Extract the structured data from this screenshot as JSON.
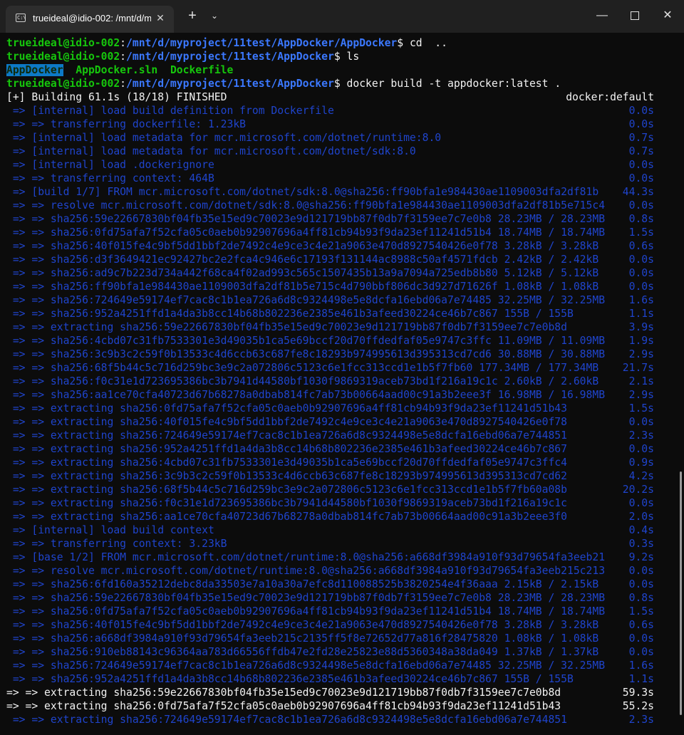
{
  "window": {
    "tab_title": "trueideal@idio-002: /mnt/d/m",
    "tab_icon": "terminal-icon",
    "tab_close": "✕",
    "new_tab": "+",
    "dropdown": "⌄",
    "minimize": "—",
    "close": "✕"
  },
  "colors": {
    "prompt_user": "#16c60c",
    "prompt_path": "#3b78ff",
    "build_lines": "#1f44cc",
    "active_lines": "#f2f2f2",
    "background": "#0c0c0c"
  },
  "terminal": {
    "prompt_user": "trueideal@idio-002",
    "prompt_path": "/mnt/d/myproject/11test/AppDocker/AppDocker",
    "prompt_path_parent": "/mnt/d/myproject/11test/AppDocker",
    "cmd_cd": "cd  ..",
    "cmd_ls": "ls",
    "ls_output": [
      "AppDocker",
      "AppDocker.sln",
      "Dockerfile"
    ],
    "cmd_build": "docker build -t appdocker:latest .",
    "status_line": "[+] Building 61.1s (18/18) FINISHED",
    "status_right": "docker:default",
    "build_lines": [
      {
        "text": " => [internal] load build definition from Dockerfile",
        "time": "0.0s",
        "style": "dim"
      },
      {
        "text": " => => transferring dockerfile: 1.23kB",
        "time": "0.0s",
        "style": "dim"
      },
      {
        "text": " => [internal] load metadata for mcr.microsoft.com/dotnet/runtime:8.0",
        "time": "0.7s",
        "style": "dim"
      },
      {
        "text": " => [internal] load metadata for mcr.microsoft.com/dotnet/sdk:8.0",
        "time": "0.7s",
        "style": "dim"
      },
      {
        "text": " => [internal] load .dockerignore",
        "time": "0.0s",
        "style": "dim"
      },
      {
        "text": " => => transferring context: 464B",
        "time": "0.0s",
        "style": "dim"
      },
      {
        "text": " => [build 1/7] FROM mcr.microsoft.com/dotnet/sdk:8.0@sha256:ff90bfa1e984430ae1109003dfa2df81b",
        "time": "44.3s",
        "style": "dim"
      },
      {
        "text": " => => resolve mcr.microsoft.com/dotnet/sdk:8.0@sha256:ff90bfa1e984430ae1109003dfa2df81b5e715c4",
        "time": "0.0s",
        "style": "dim"
      },
      {
        "text": " => => sha256:59e22667830bf04fb35e15ed9c70023e9d121719bb87f0db7f3159ee7c7e0b8 28.23MB / 28.23MB",
        "time": "0.8s",
        "style": "dim"
      },
      {
        "text": " => => sha256:0fd75afa7f52cfa05c0aeb0b92907696a4ff81cb94b93f9da23ef11241d51b4 18.74MB / 18.74MB",
        "time": "1.5s",
        "style": "dim"
      },
      {
        "text": " => => sha256:40f015fe4c9bf5dd1bbf2de7492c4e9ce3c4e21a9063e470d8927540426e0f78 3.28kB / 3.28kB",
        "time": "0.6s",
        "style": "dim"
      },
      {
        "text": " => => sha256:d3f3649421ec92427bc2e2fca4c946e6c17193f131144ac8988c50af4571fdcb 2.42kB / 2.42kB",
        "time": "0.0s",
        "style": "dim"
      },
      {
        "text": " => => sha256:ad9c7b223d734a442f68ca4f02ad993c565c1507435b13a9a7094a725edb8b80 5.12kB / 5.12kB",
        "time": "0.0s",
        "style": "dim"
      },
      {
        "text": " => => sha256:ff90bfa1e984430ae1109003dfa2df81b5e715c4d790bbf806dc3d927d71626f 1.08kB / 1.08kB",
        "time": "0.0s",
        "style": "dim"
      },
      {
        "text": " => => sha256:724649e59174ef7cac8c1b1ea726a6d8c9324498e5e8dcfa16ebd06a7e74485 32.25MB / 32.25MB",
        "time": "1.6s",
        "style": "dim"
      },
      {
        "text": " => => sha256:952a4251ffd1a4da3b8cc14b68b802236e2385e461b3afeed30224ce46b7c867 155B / 155B",
        "time": "1.1s",
        "style": "dim"
      },
      {
        "text": " => => extracting sha256:59e22667830bf04fb35e15ed9c70023e9d121719bb87f0db7f3159ee7c7e0b8d",
        "time": "3.9s",
        "style": "dim"
      },
      {
        "text": " => => sha256:4cbd07c31fb7533301e3d49035b1ca5e69bccf20d70ffdedfaf05e9747c3ffc 11.09MB / 11.09MB",
        "time": "1.9s",
        "style": "dim"
      },
      {
        "text": " => => sha256:3c9b3c2c59f0b13533c4d6ccb63c687fe8c18293b974995613d395313cd7cd6 30.88MB / 30.88MB",
        "time": "2.9s",
        "style": "dim"
      },
      {
        "text": " => => sha256:68f5b44c5c716d259bc3e9c2a072806c5123c6e1fcc313ccd1e1b5f7fb60 177.34MB / 177.34MB",
        "time": "21.7s",
        "style": "dim"
      },
      {
        "text": " => => sha256:f0c31e1d723695386bc3b7941d44580bf1030f9869319aceb73bd1f216a19c1c 2.60kB / 2.60kB",
        "time": "2.1s",
        "style": "dim"
      },
      {
        "text": " => => sha256:aa1ce70cfa40723d67b68278a0dbab814fc7ab73b00664aad00c91a3b2eee3f 16.98MB / 16.98MB",
        "time": "2.9s",
        "style": "dim"
      },
      {
        "text": " => => extracting sha256:0fd75afa7f52cfa05c0aeb0b92907696a4ff81cb94b93f9da23ef11241d51b43",
        "time": "1.5s",
        "style": "dim"
      },
      {
        "text": " => => extracting sha256:40f015fe4c9bf5dd1bbf2de7492c4e9ce3c4e21a9063e470d8927540426e0f78",
        "time": "0.0s",
        "style": "dim"
      },
      {
        "text": " => => extracting sha256:724649e59174ef7cac8c1b1ea726a6d8c9324498e5e8dcfa16ebd06a7e744851",
        "time": "2.3s",
        "style": "dim"
      },
      {
        "text": " => => extracting sha256:952a4251ffd1a4da3b8cc14b68b802236e2385e461b3afeed30224ce46b7c867",
        "time": "0.0s",
        "style": "dim"
      },
      {
        "text": " => => extracting sha256:4cbd07c31fb7533301e3d49035b1ca5e69bccf20d70ffdedfaf05e9747c3ffc4",
        "time": "0.9s",
        "style": "dim"
      },
      {
        "text": " => => extracting sha256:3c9b3c2c59f0b13533c4d6ccb63c687fe8c18293b974995613d395313cd7cd62",
        "time": "4.2s",
        "style": "dim"
      },
      {
        "text": " => => extracting sha256:68f5b44c5c716d259bc3e9c2a072806c5123c6e1fcc313ccd1e1b5f7fb60a08b",
        "time": "20.2s",
        "style": "dim"
      },
      {
        "text": " => => extracting sha256:f0c31e1d723695386bc3b7941d44580bf1030f9869319aceb73bd1f216a19c1c",
        "time": "0.0s",
        "style": "dim"
      },
      {
        "text": " => => extracting sha256:aa1ce70cfa40723d67b68278a0dbab814fc7ab73b00664aad00c91a3b2eee3f0",
        "time": "2.0s",
        "style": "dim"
      },
      {
        "text": " => [internal] load build context",
        "time": "0.4s",
        "style": "dim"
      },
      {
        "text": " => => transferring context: 3.23kB",
        "time": "0.3s",
        "style": "dim"
      },
      {
        "text": " => [base 1/2] FROM mcr.microsoft.com/dotnet/runtime:8.0@sha256:a668df3984a910f93d79654fa3eeb21",
        "time": "9.2s",
        "style": "dim"
      },
      {
        "text": " => => resolve mcr.microsoft.com/dotnet/runtime:8.0@sha256:a668df3984a910f93d79654fa3eeb215c213",
        "time": "0.0s",
        "style": "dim"
      },
      {
        "text": " => => sha256:6fd160a35212debc8da33503e7a10a30a7efc8d110088525b3820254e4f36aaa 2.15kB / 2.15kB",
        "time": "0.0s",
        "style": "dim"
      },
      {
        "text": " => => sha256:59e22667830bf04fb35e15ed9c70023e9d121719bb87f0db7f3159ee7c7e0b8 28.23MB / 28.23MB",
        "time": "0.8s",
        "style": "dim"
      },
      {
        "text": " => => sha256:0fd75afa7f52cfa05c0aeb0b92907696a4ff81cb94b93f9da23ef11241d51b4 18.74MB / 18.74MB",
        "time": "1.5s",
        "style": "dim"
      },
      {
        "text": " => => sha256:40f015fe4c9bf5dd1bbf2de7492c4e9ce3c4e21a9063e470d8927540426e0f78 3.28kB / 3.28kB",
        "time": "0.6s",
        "style": "dim"
      },
      {
        "text": " => => sha256:a668df3984a910f93d79654fa3eeb215c2135ff5f8e72652d77a816f28475820 1.08kB / 1.08kB",
        "time": "0.0s",
        "style": "dim"
      },
      {
        "text": " => => sha256:910eb88143c96364aa783d66556ffdb47e2fd28e25823e88d5360348a38da049 1.37kB / 1.37kB",
        "time": "0.0s",
        "style": "dim"
      },
      {
        "text": " => => sha256:724649e59174ef7cac8c1b1ea726a6d8c9324498e5e8dcfa16ebd06a7e74485 32.25MB / 32.25MB",
        "time": "1.6s",
        "style": "dim"
      },
      {
        "text": " => => sha256:952a4251ffd1a4da3b8cc14b68b802236e2385e461b3afeed30224ce46b7c867 155B / 155B",
        "time": "1.1s",
        "style": "dim"
      },
      {
        "text": "=> => extracting sha256:59e22667830bf04fb35e15ed9c70023e9d121719bb87f0db7f3159ee7c7e0b8d",
        "time": "59.3s",
        "style": "bright"
      },
      {
        "text": "=> => extracting sha256:0fd75afa7f52cfa05c0aeb0b92907696a4ff81cb94b93f9da23ef11241d51b43",
        "time": "55.2s",
        "style": "bright"
      },
      {
        "text": " => => extracting sha256:724649e59174ef7cac8c1b1ea726a6d8c9324498e5e8dcfa16ebd06a7e744851",
        "time": "2.3s",
        "style": "dim"
      }
    ]
  }
}
